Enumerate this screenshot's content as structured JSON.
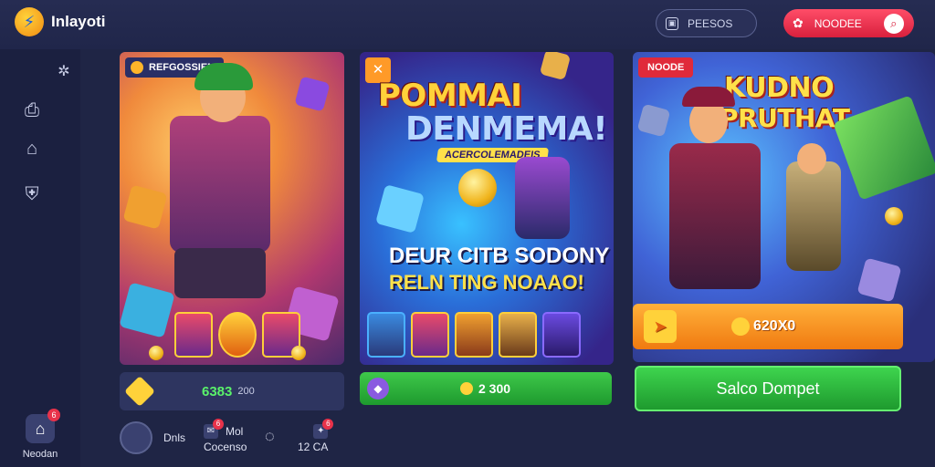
{
  "app": {
    "title": "Inlayoti"
  },
  "topbar": {
    "button1_label": "PEESOS",
    "button2_label": "NOODEE"
  },
  "sidebar": {
    "bottom_label": "Neodan",
    "bottom_badge": "6"
  },
  "card1": {
    "tag": "REFGOSSIEN",
    "price_value": "6383",
    "price_unit": "200"
  },
  "card2": {
    "headline_1": "POMMAI",
    "headline_2": "DENMEMA!",
    "sub_banner": "ACERCOLEMADEIS",
    "caption_1": "DEUR CITB SODONY",
    "caption_2": "RELN TING NOAAO!",
    "price_value": "2 300"
  },
  "card3": {
    "tag": "NOODE",
    "headline_1": "KUDNO",
    "headline_2": "PRUTHAT",
    "bar_value": "620X0",
    "button_label": "Salco Dompet"
  },
  "bottom": {
    "item1": "Dnls",
    "item2_top": "Mol",
    "item2_bottom": "Cocenso",
    "item3": "12 CA",
    "badge": "6"
  },
  "colors": {
    "accent_red": "#e8324a",
    "accent_green": "#3ec84a",
    "accent_orange": "#ff9a28",
    "background": "#1f2545"
  }
}
